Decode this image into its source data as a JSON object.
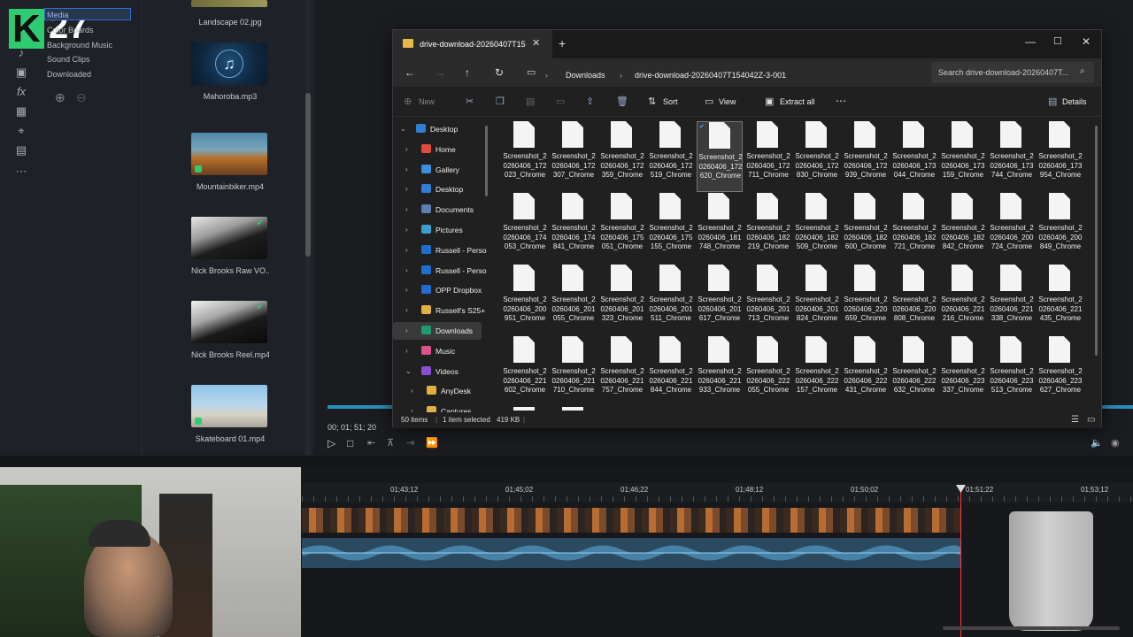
{
  "nav": {
    "badge_number": "27",
    "items": [
      "Media",
      "Color Boards",
      "Background Music",
      "Sound Clips",
      "Downloaded"
    ]
  },
  "media": {
    "items": [
      {
        "label": "Landscape 02.jpg"
      },
      {
        "label": "Mahoroba.mp3"
      },
      {
        "label": "Mountainbiker.mp4"
      },
      {
        "label": "Nick Brooks Raw VO..."
      },
      {
        "label": "Nick Brooks Reel.mp4"
      },
      {
        "label": "Skateboard 01.mp4"
      }
    ]
  },
  "explorer": {
    "tab_title": "drive-download-20260407T15",
    "breadcrumb": [
      "Downloads",
      "drive-download-20260407T154042Z-3-001"
    ],
    "search_placeholder": "Search drive-download-20260407T...",
    "toolbar": {
      "new": "New",
      "sort": "Sort",
      "view": "View",
      "extract": "Extract all",
      "details": "Details"
    },
    "tree": [
      {
        "label": "Desktop",
        "level": 0,
        "expanded": true
      },
      {
        "label": "Home",
        "level": 1
      },
      {
        "label": "Gallery",
        "level": 1
      },
      {
        "label": "Desktop",
        "level": 1
      },
      {
        "label": "Documents",
        "level": 1
      },
      {
        "label": "Pictures",
        "level": 1
      },
      {
        "label": "Russell - Perso",
        "level": 1
      },
      {
        "label": "Russell - Perso",
        "level": 1
      },
      {
        "label": "OPP Dropbox",
        "level": 1
      },
      {
        "label": "Russell's S25+",
        "level": 1
      },
      {
        "label": "Downloads",
        "level": 1,
        "selected": true
      },
      {
        "label": "Music",
        "level": 1
      },
      {
        "label": "Videos",
        "level": 1,
        "expanded": true
      },
      {
        "label": "AnyDesk",
        "level": 2
      },
      {
        "label": "Captures",
        "level": 2
      }
    ],
    "files": [
      "Screenshot_20260406_172023_Chrome",
      "Screenshot_20260406_172307_Chrome",
      "Screenshot_20260406_172359_Chrome",
      "Screenshot_20260406_172519_Chrome",
      "Screenshot_20260406_172620_Chrome",
      "Screenshot_20260406_172711_Chrome",
      "Screenshot_20260406_172830_Chrome",
      "Screenshot_20260406_172939_Chrome",
      "Screenshot_20260406_173044_Chrome",
      "Screenshot_20260406_173159_Chrome",
      "Screenshot_20260406_173744_Chrome",
      "Screenshot_20260406_173954_Chrome",
      "Screenshot_20260406_174053_Chrome",
      "Screenshot_20260406_174841_Chrome",
      "Screenshot_20260406_175051_Chrome",
      "Screenshot_20260406_175155_Chrome",
      "Screenshot_20260406_181748_Chrome",
      "Screenshot_20260406_182219_Chrome",
      "Screenshot_20260406_182509_Chrome",
      "Screenshot_20260406_182600_Chrome",
      "Screenshot_20260406_182721_Chrome",
      "Screenshot_20260406_182842_Chrome",
      "Screenshot_20260406_200724_Chrome",
      "Screenshot_20260406_200849_Chrome",
      "Screenshot_20260406_200951_Chrome",
      "Screenshot_20260406_201055_Chrome",
      "Screenshot_20260406_201323_Chrome",
      "Screenshot_20260406_201511_Chrome",
      "Screenshot_20260406_201617_Chrome",
      "Screenshot_20260406_201713_Chrome",
      "Screenshot_20260406_201824_Chrome",
      "Screenshot_20260406_220659_Chrome",
      "Screenshot_20260406_220808_Chrome",
      "Screenshot_20260406_221216_Chrome",
      "Screenshot_20260406_221338_Chrome",
      "Screenshot_20260406_221435_Chrome",
      "Screenshot_20260406_221602_Chrome",
      "Screenshot_20260406_221710_Chrome",
      "Screenshot_20260406_221757_Chrome",
      "Screenshot_20260406_221844_Chrome",
      "Screenshot_20260406_221933_Chrome",
      "Screenshot_20260406_222055_Chrome",
      "Screenshot_20260406_222157_Chrome",
      "Screenshot_20260406_222431_Chrome",
      "Screenshot_20260406_222632_Chrome",
      "Screenshot_20260406_223337_Chrome",
      "Screenshot_20260406_223513_Chrome",
      "Screenshot_20260406_223627_Chrome"
    ],
    "selected_file_index": 4,
    "status": {
      "items": "50 items",
      "selected": "1 item selected",
      "size": "419 KB"
    }
  },
  "playback": {
    "timecode": "00; 01; 51; 20"
  },
  "timeline": {
    "ruler": [
      "01;43;12",
      "01;45;02",
      "01;46;22",
      "01;48;12",
      "01;50;02",
      "01;51;22",
      "01;53;12"
    ]
  },
  "colors": {
    "accent_green": "#2ecc71",
    "selection_blue": "#2f6fd1",
    "playhead": "#ff3b3b"
  }
}
